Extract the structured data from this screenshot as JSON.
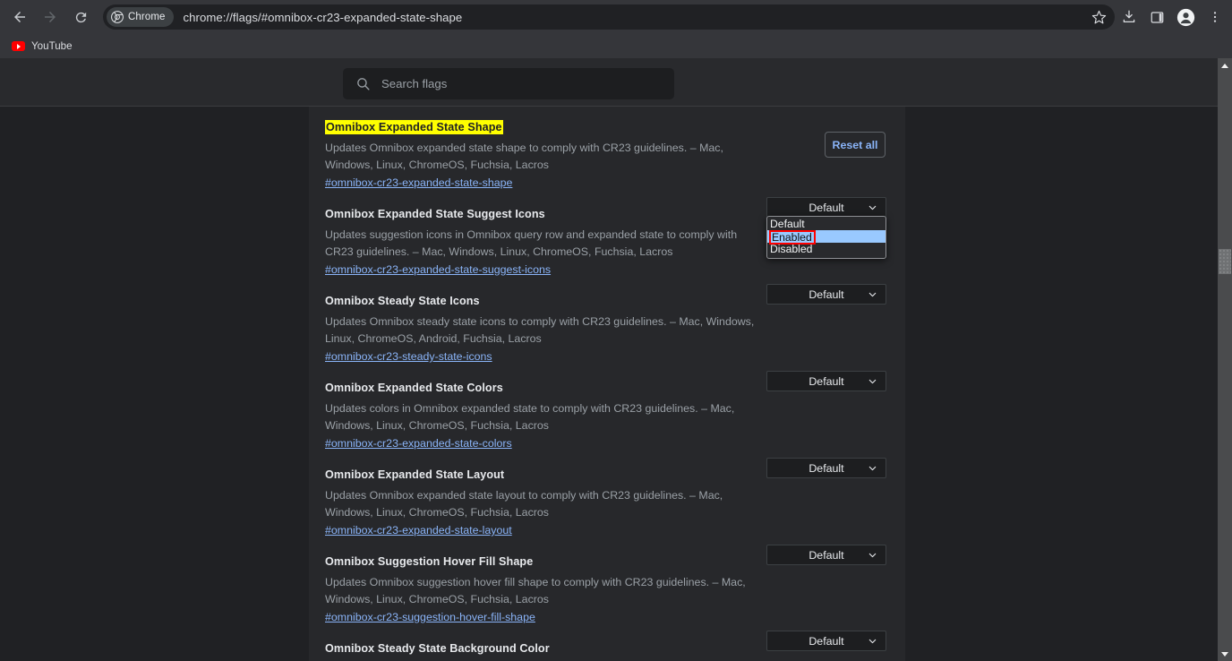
{
  "browser": {
    "nav": {
      "back_label": "Back",
      "forward_label": "Forward",
      "reload_label": "Reload"
    },
    "omnibox": {
      "chip_label": "Chrome",
      "url": "chrome://flags/#omnibox-cr23-expanded-state-shape",
      "star_label": "Bookmark this tab"
    },
    "toolbar_icons": [
      {
        "name": "downloads-icon",
        "label": "Downloads"
      },
      {
        "name": "side-panel-icon",
        "label": "Side panel"
      },
      {
        "name": "profile-icon",
        "label": "Profile"
      },
      {
        "name": "menu-icon",
        "label": "Customize and control Google Chrome"
      }
    ],
    "bookmarks": [
      {
        "label": "YouTube",
        "icon": "youtube-icon"
      }
    ]
  },
  "flags_page": {
    "search": {
      "placeholder": "Search flags",
      "value": ""
    },
    "reset_label": "Reset all",
    "select_options": [
      "Default",
      "Enabled",
      "Disabled"
    ],
    "open_dropdown": {
      "highlighted_option": "Enabled",
      "options": [
        "Default",
        "Enabled",
        "Disabled"
      ],
      "highlight_color": "#99c9ff",
      "focus_outline_color": "#ff0000"
    },
    "highlight_color": "#ffff00",
    "entries": [
      {
        "title": "Omnibox Expanded State Shape",
        "highlighted": true,
        "description": "Updates Omnibox expanded state shape to comply with CR23 guidelines. – Mac, Windows, Linux, ChromeOS, Fuchsia, Lacros",
        "link": "#omnibox-cr23-expanded-state-shape",
        "select_value": "Default",
        "dropdown_open": true
      },
      {
        "title": "Omnibox Expanded State Suggest Icons",
        "highlighted": false,
        "description": "Updates suggestion icons in Omnibox query row and expanded state to comply with CR23 guidelines. – Mac, Windows, Linux, ChromeOS, Fuchsia, Lacros",
        "link": "#omnibox-cr23-expanded-state-suggest-icons",
        "select_value": "Default",
        "dropdown_open": false
      },
      {
        "title": "Omnibox Steady State Icons",
        "highlighted": false,
        "description": "Updates Omnibox steady state icons to comply with CR23 guidelines. – Mac, Windows, Linux, ChromeOS, Android, Fuchsia, Lacros",
        "link": "#omnibox-cr23-steady-state-icons",
        "select_value": "Default",
        "dropdown_open": false
      },
      {
        "title": "Omnibox Expanded State Colors",
        "highlighted": false,
        "description": "Updates colors in Omnibox expanded state to comply with CR23 guidelines. – Mac, Windows, Linux, ChromeOS, Fuchsia, Lacros",
        "link": "#omnibox-cr23-expanded-state-colors",
        "select_value": "Default",
        "dropdown_open": false
      },
      {
        "title": "Omnibox Expanded State Layout",
        "highlighted": false,
        "description": "Updates Omnibox expanded state layout to comply with CR23 guidelines. – Mac, Windows, Linux, ChromeOS, Fuchsia, Lacros",
        "link": "#omnibox-cr23-expanded-state-layout",
        "select_value": "Default",
        "dropdown_open": false
      },
      {
        "title": "Omnibox Suggestion Hover Fill Shape",
        "highlighted": false,
        "description": "Updates Omnibox suggestion hover fill shape to comply with CR23 guidelines. – Mac, Windows, Linux, ChromeOS, Fuchsia, Lacros",
        "link": "#omnibox-cr23-suggestion-hover-fill-shape",
        "select_value": "Default",
        "dropdown_open": false
      },
      {
        "title": "Omnibox Steady State Background Color",
        "highlighted": false,
        "description": "",
        "link": "",
        "select_value": "",
        "dropdown_open": false
      }
    ]
  }
}
